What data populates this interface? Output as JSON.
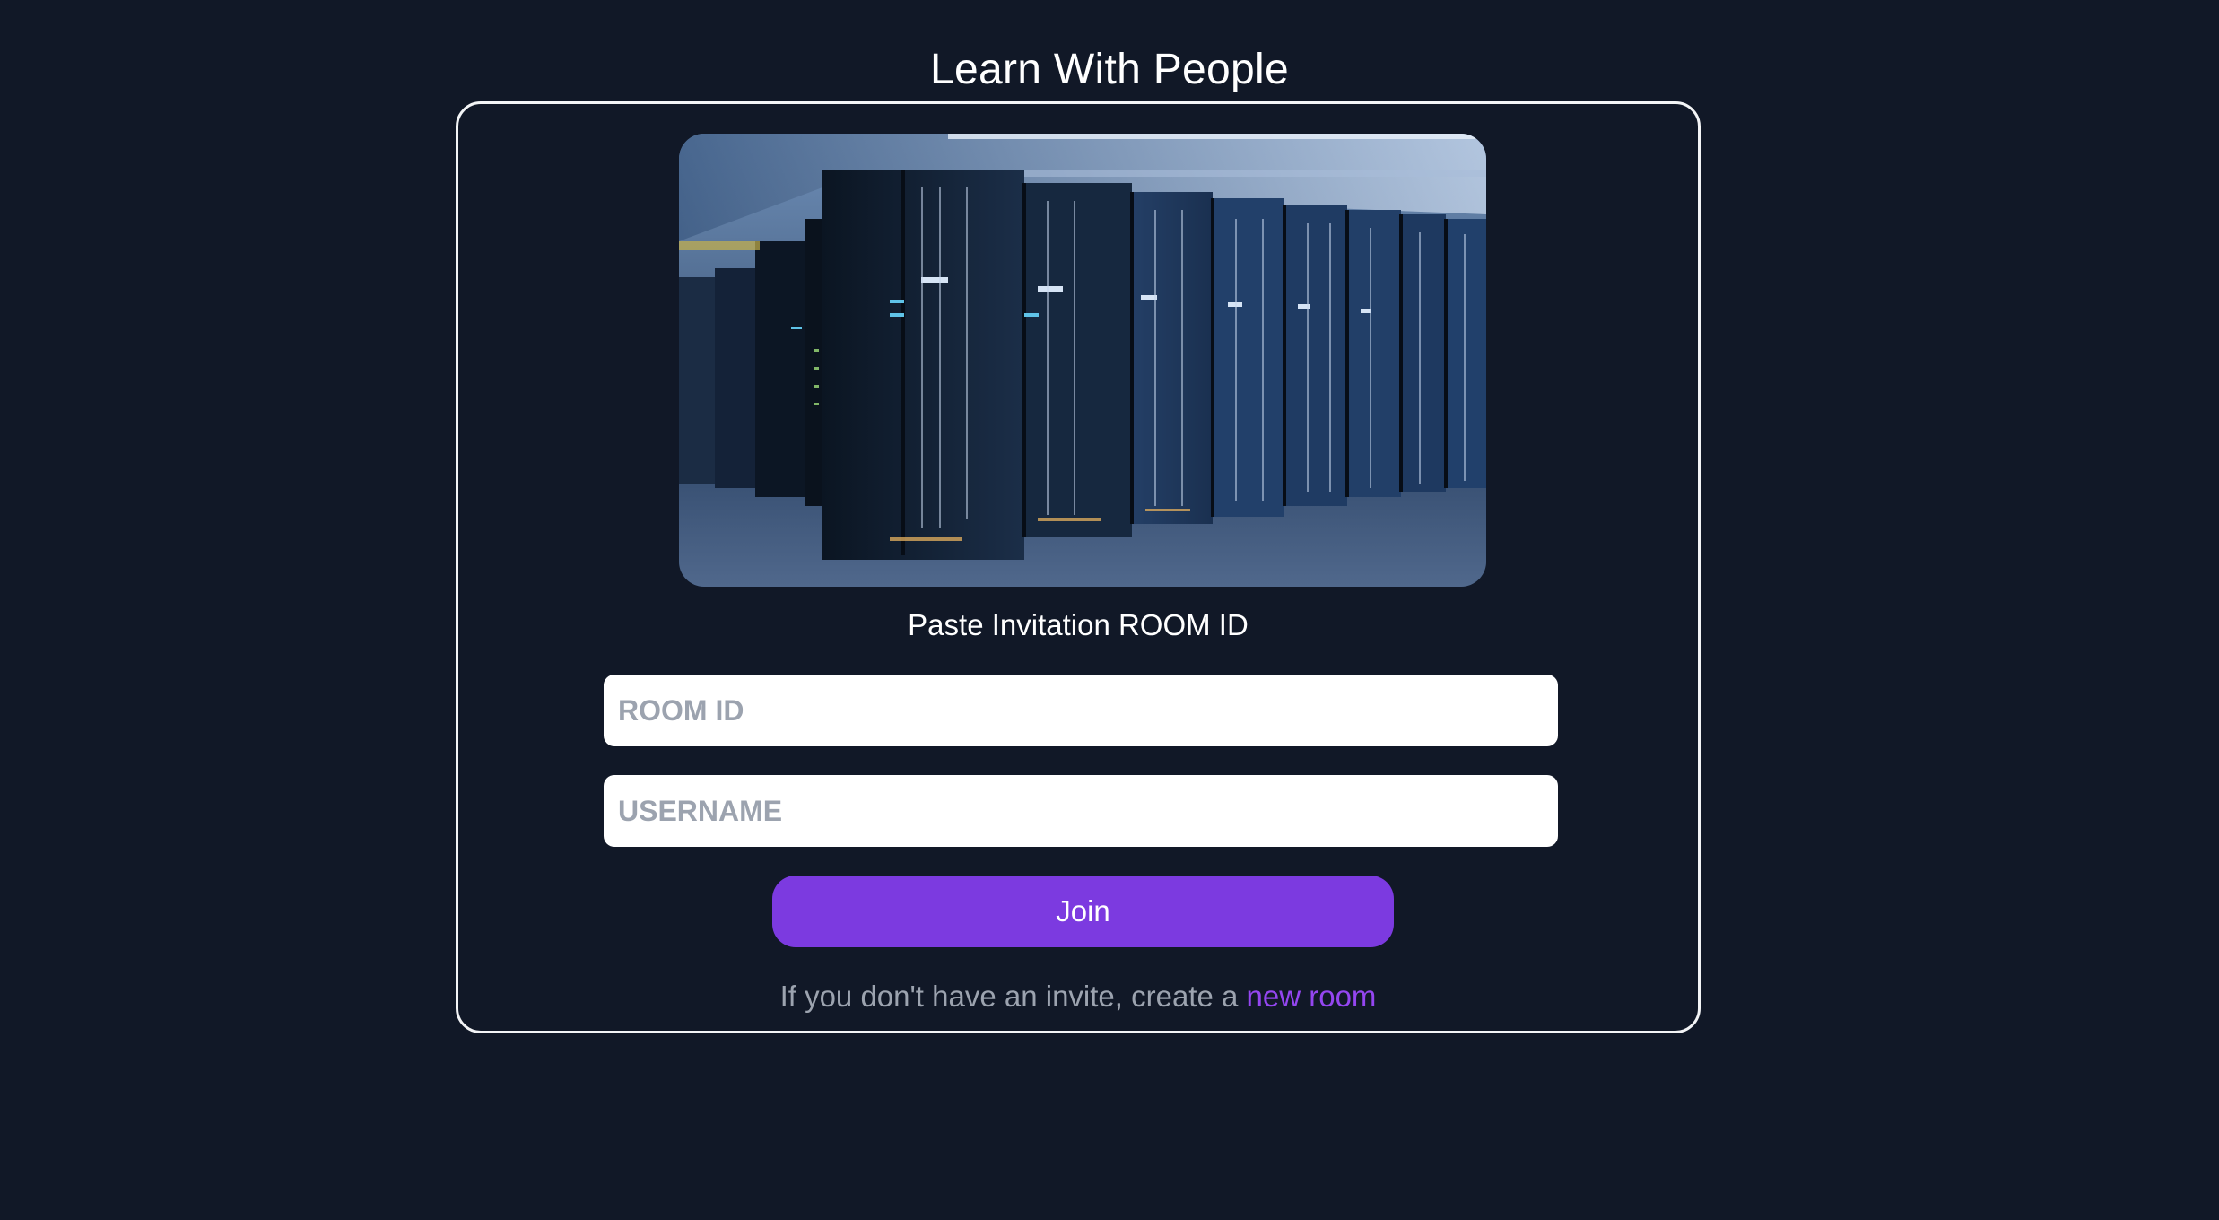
{
  "header": {
    "title": "Learn With People"
  },
  "hero": {
    "image": "server-room-photo",
    "colors": [
      "#0d1a2b",
      "#2a4a78",
      "#c7d6ea"
    ]
  },
  "form": {
    "prompt": "Paste Invitation ROOM ID",
    "room_id_placeholder": "ROOM ID",
    "room_id_value": "",
    "username_placeholder": "USERNAME",
    "username_value": "",
    "join_label": "Join"
  },
  "footer": {
    "text": "If you don't have an invite, create a ",
    "link_label": "new room"
  },
  "colors": {
    "background": "#111827",
    "accent": "#7c3ae0",
    "link": "#9446f0",
    "muted_text": "#9ca3af"
  }
}
